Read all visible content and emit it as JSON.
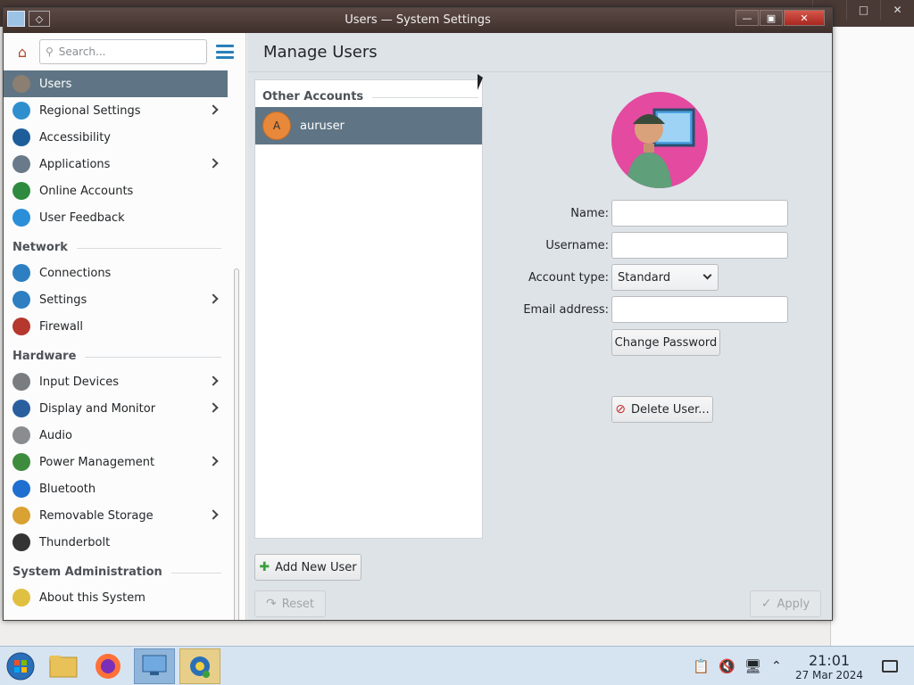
{
  "window": {
    "title": "Users — System Settings"
  },
  "sidebar": {
    "search_placeholder": "Search...",
    "items_top": [
      {
        "label": "Users",
        "icon": "users-icon",
        "color": "#8a7f70",
        "selected": true,
        "arrow": false
      },
      {
        "label": "Regional Settings",
        "icon": "globe-icon",
        "color": "#2f8fce",
        "arrow": true
      },
      {
        "label": "Accessibility",
        "icon": "accessibility-icon",
        "color": "#1d5e9a",
        "arrow": false
      },
      {
        "label": "Applications",
        "icon": "applications-icon",
        "color": "#6a7a8a",
        "arrow": true
      },
      {
        "label": "Online Accounts",
        "icon": "online-accounts-icon",
        "color": "#2d8a3e",
        "arrow": false
      },
      {
        "label": "User Feedback",
        "icon": "user-feedback-icon",
        "color": "#2a8fd8",
        "arrow": false
      }
    ],
    "section_network": "Network",
    "items_network": [
      {
        "label": "Connections",
        "icon": "connections-icon",
        "color": "#2d7fc1",
        "arrow": false
      },
      {
        "label": "Settings",
        "icon": "network-settings-icon",
        "color": "#2d7fc1",
        "arrow": true
      },
      {
        "label": "Firewall",
        "icon": "firewall-icon",
        "color": "#b5372d",
        "arrow": false
      }
    ],
    "section_hardware": "Hardware",
    "items_hardware": [
      {
        "label": "Input Devices",
        "icon": "keyboard-icon",
        "color": "#7a7d80",
        "arrow": true
      },
      {
        "label": "Display and Monitor",
        "icon": "monitor-icon",
        "color": "#2a5f9e",
        "arrow": true
      },
      {
        "label": "Audio",
        "icon": "speaker-icon",
        "color": "#8a8d90",
        "arrow": false
      },
      {
        "label": "Power Management",
        "icon": "power-icon",
        "color": "#3d8c3d",
        "arrow": true
      },
      {
        "label": "Bluetooth",
        "icon": "bluetooth-icon",
        "color": "#1f6fd0",
        "arrow": false
      },
      {
        "label": "Removable Storage",
        "icon": "removable-storage-icon",
        "color": "#d9a233",
        "arrow": true
      },
      {
        "label": "Thunderbolt",
        "icon": "thunderbolt-icon",
        "color": "#333333",
        "arrow": false
      }
    ],
    "section_sysadmin": "System Administration",
    "items_sysadmin": [
      {
        "label": "About this System",
        "icon": "lightbulb-icon",
        "color": "#e0c040",
        "arrow": false
      }
    ]
  },
  "content": {
    "title": "Manage Users",
    "accounts_header": "Other Accounts",
    "user": {
      "initial": "A",
      "name": "auruser"
    },
    "form": {
      "name_label": "Name:",
      "name_value": "",
      "username_label": "Username:",
      "username_value": "",
      "account_type_label": "Account type:",
      "account_type_value": "Standard",
      "email_label": "Email address:",
      "email_value": ""
    },
    "change_password": "Change Password",
    "delete_user": "Delete User...",
    "add_user": "Add New User",
    "reset": "Reset",
    "apply": "Apply"
  },
  "taskbar": {
    "time": "21:01",
    "date": "27 Mar 2024"
  }
}
